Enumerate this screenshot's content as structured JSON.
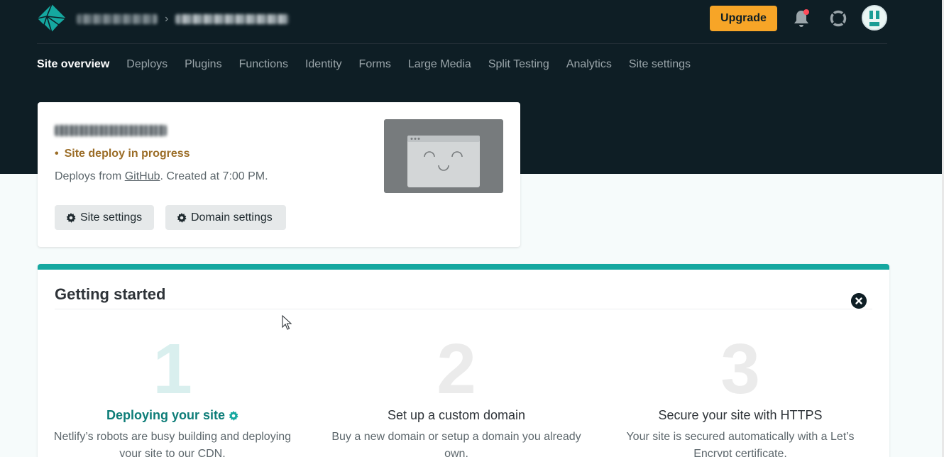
{
  "header": {
    "account_name": "",
    "site_slug": "",
    "separator": "›",
    "upgrade_label": "Upgrade",
    "icons": [
      "netlify-logo-icon",
      "bell-icon",
      "help-lifebuoy-icon",
      "avatar"
    ],
    "colors": {
      "background": "#0e1e25",
      "upgrade": "#f7a527",
      "notification_dot": "#ff4b5a"
    }
  },
  "nav": {
    "tabs": [
      {
        "label": "Site overview",
        "active": true
      },
      {
        "label": "Deploys"
      },
      {
        "label": "Plugins"
      },
      {
        "label": "Functions"
      },
      {
        "label": "Identity"
      },
      {
        "label": "Forms"
      },
      {
        "label": "Large Media"
      },
      {
        "label": "Split Testing"
      },
      {
        "label": "Analytics"
      },
      {
        "label": "Site settings"
      }
    ]
  },
  "site": {
    "status_dot": "•",
    "status": "Site deploy in progress",
    "deploys_from_prefix": "Deploys from ",
    "deploys_from_link": "GitHub",
    "created_text": ". Created at 7:00 PM.",
    "site_settings_label": "Site settings",
    "domain_settings_label": "Domain settings",
    "colors": {
      "status": "#9b6d27"
    }
  },
  "getting_started": {
    "title": "Getting started",
    "accent": "#15a8a0",
    "steps": [
      {
        "number": "1",
        "title": "Deploying your site",
        "description": "Netlify’s robots are busy building and deploying your site to our CDN."
      },
      {
        "number": "2",
        "title": "Set up a custom domain",
        "description": "Buy a new domain or setup a domain you already own."
      },
      {
        "number": "3",
        "title": "Secure your site with HTTPS",
        "description": "Your site is secured automatically with a Let’s Encrypt certificate."
      }
    ]
  }
}
